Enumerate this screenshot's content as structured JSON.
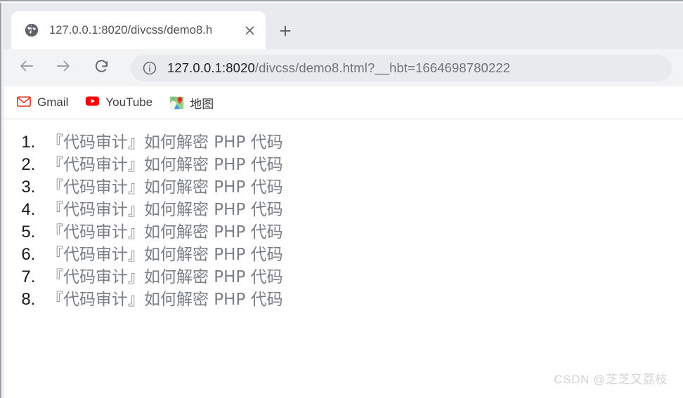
{
  "browser": {
    "tab": {
      "favicon": "globe-icon",
      "title": "127.0.0.1:8020/divcss/demo8.h",
      "close_label": "✕"
    },
    "new_tab_label": "+",
    "toolbar": {
      "back_icon": "back-arrow-icon",
      "forward_icon": "forward-arrow-icon",
      "reload_icon": "reload-icon",
      "info_icon": "info-circle-icon",
      "url_host": "127.0.0.1:8020",
      "url_path": "/divcss/demo8.html?__hbt=1664698780222",
      "url_full": "127.0.0.1:8020/divcss/demo8.html?__hbt=1664698780222"
    },
    "bookmarks": [
      {
        "label": "Gmail",
        "icon": "gmail-icon"
      },
      {
        "label": "YouTube",
        "icon": "youtube-icon"
      },
      {
        "label": "地图",
        "icon": "google-maps-icon"
      }
    ]
  },
  "page": {
    "list": [
      {
        "n": 1,
        "text": "『代码审计』如何解密 PHP 代码"
      },
      {
        "n": 2,
        "text": "『代码审计』如何解密 PHP 代码"
      },
      {
        "n": 3,
        "text": "『代码审计』如何解密 PHP 代码"
      },
      {
        "n": 4,
        "text": "『代码审计』如何解密 PHP 代码"
      },
      {
        "n": 5,
        "text": "『代码审计』如何解密 PHP 代码"
      },
      {
        "n": 6,
        "text": "『代码审计』如何解密 PHP 代码"
      },
      {
        "n": 7,
        "text": "『代码审计』如何解密 PHP 代码"
      },
      {
        "n": 8,
        "text": "『代码审计』如何解密 PHP 代码"
      }
    ],
    "watermark": "CSDN @芝芝又荔枝"
  },
  "colors": {
    "tabstrip_bg": "#e8eaed",
    "toolbar_bg": "#f1f3f4",
    "omnibox_bg": "#e8eaed",
    "page_bg": "#ffffff",
    "list_text": "#7a7f86",
    "list_marker": "#1a1a1a",
    "watermark": "#d2d3d6",
    "gmail_red": "#ea4335",
    "youtube_red": "#ff0000"
  }
}
